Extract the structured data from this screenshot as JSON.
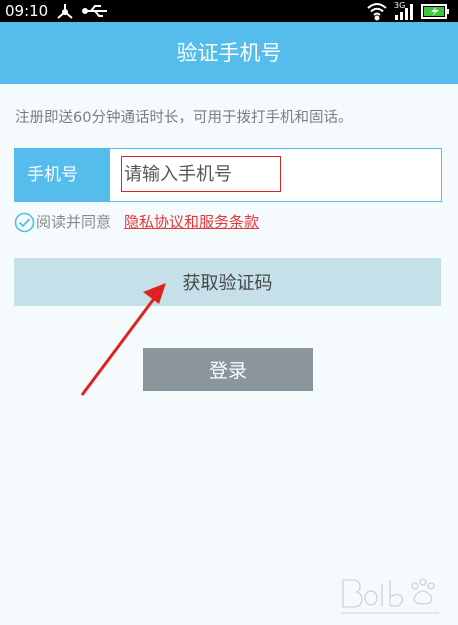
{
  "status_bar": {
    "time": "09:10",
    "left_icons": [
      "network-share-icon",
      "usb-icon"
    ],
    "right_icons": [
      "wifi-icon",
      "signal-3g-icon",
      "battery-icon"
    ],
    "network_type": "3G"
  },
  "header": {
    "title": "验证手机号"
  },
  "promo": {
    "text": "注册即送60分钟通话时长，可用于拨打手机和固话。"
  },
  "phone_field": {
    "label": "手机号",
    "placeholder": "请输入手机号",
    "value": ""
  },
  "agreement": {
    "text": "阅读并同意",
    "link": "隐私协议和服务条款"
  },
  "buttons": {
    "get_code": "获取验证码",
    "login": "登录"
  },
  "colors": {
    "header": "#55bdec",
    "code_button": "#c6e0e9",
    "login_button": "#8a969c",
    "link": "#e4393c",
    "annotation": "#e0211f"
  }
}
